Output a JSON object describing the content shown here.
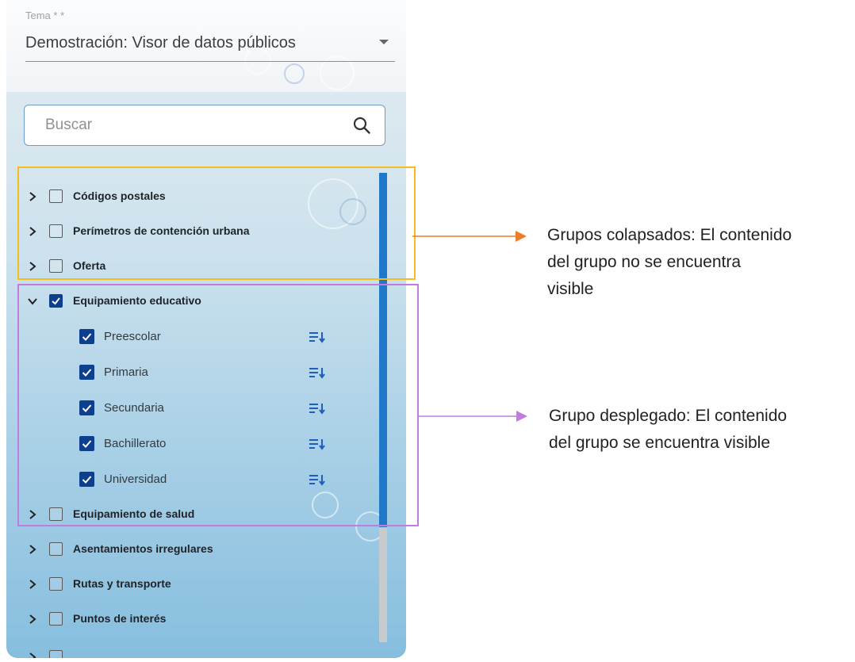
{
  "tema": {
    "label": "Tema * *",
    "value": "Demostración: Visor de datos públicos"
  },
  "search": {
    "placeholder": "Buscar"
  },
  "layers": {
    "collapsed_top": [
      {
        "label": "Códigos postales",
        "checked": false
      },
      {
        "label": "Perímetros de contención urbana",
        "checked": false
      },
      {
        "label": "Oferta",
        "checked": false
      }
    ],
    "expanded": {
      "label": "Equipamiento educativo",
      "checked": true,
      "children": [
        {
          "label": "Preescolar",
          "checked": true
        },
        {
          "label": "Primaria",
          "checked": true
        },
        {
          "label": "Secundaria",
          "checked": true
        },
        {
          "label": "Bachillerato",
          "checked": true
        },
        {
          "label": "Universidad",
          "checked": true
        }
      ]
    },
    "collapsed_bottom": [
      {
        "label": "Equipamiento de salud",
        "checked": false
      },
      {
        "label": "Asentamientos irregulares",
        "checked": false
      },
      {
        "label": "Rutas y transporte",
        "checked": false
      },
      {
        "label": "Puntos de interés",
        "checked": false
      }
    ]
  },
  "annotations": {
    "collapsed": {
      "line1": "Grupos colapsados: El contenido",
      "line2": "del grupo no se encuentra",
      "line3": "visible"
    },
    "expanded": {
      "line1": "Grupo desplegado: El contenido",
      "line2": "del grupo se encuentra visible"
    }
  },
  "colors": {
    "accent_blue": "#0d3f8f",
    "scroll_thumb": "#1f78c8",
    "highlight_collapsed": "#f6bd1d",
    "highlight_expanded": "#c27ce0",
    "arrow_collapsed": "#f07b26",
    "arrow_expanded": "#c27ce0"
  },
  "icons": [
    "search-icon",
    "chevron-right-icon",
    "chevron-down-icon",
    "checkbox-icon",
    "sort-icon"
  ]
}
